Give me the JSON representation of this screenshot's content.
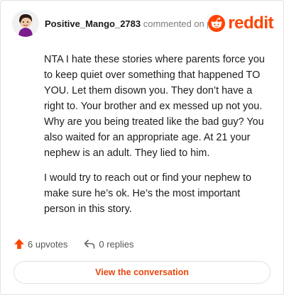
{
  "header": {
    "username": "Positive_Mango_2783",
    "action_text": "commented on",
    "target_link": "post",
    "brand_name": "reddit",
    "brand_color": "#ff4500"
  },
  "comment": {
    "paragraphs": [
      "NTA I hate these stories where parents force you to keep quiet over something that happened TO YOU. Let them disown you. They don’t have a right to. Your brother and ex messed up not you. Why are you being treated like the bad guy? You also waited for an appropriate age. At 21 your nephew is an adult. They lied to him.",
      "I would try to reach out or find your nephew to make sure he’s ok. He’s the most important person in this story."
    ]
  },
  "actions": {
    "upvotes_label": "6 upvotes",
    "replies_label": "0 replies"
  },
  "cta": {
    "label": "View the conversation"
  },
  "icons": {
    "avatar": "avatar-icon",
    "brand": "reddit-logo-icon",
    "upvote": "upvote-arrow-icon",
    "reply": "reply-arrow-icon"
  },
  "colors": {
    "accent": "#ff4500",
    "link": "#1f6fcf",
    "cta_text": "#e8470e"
  }
}
